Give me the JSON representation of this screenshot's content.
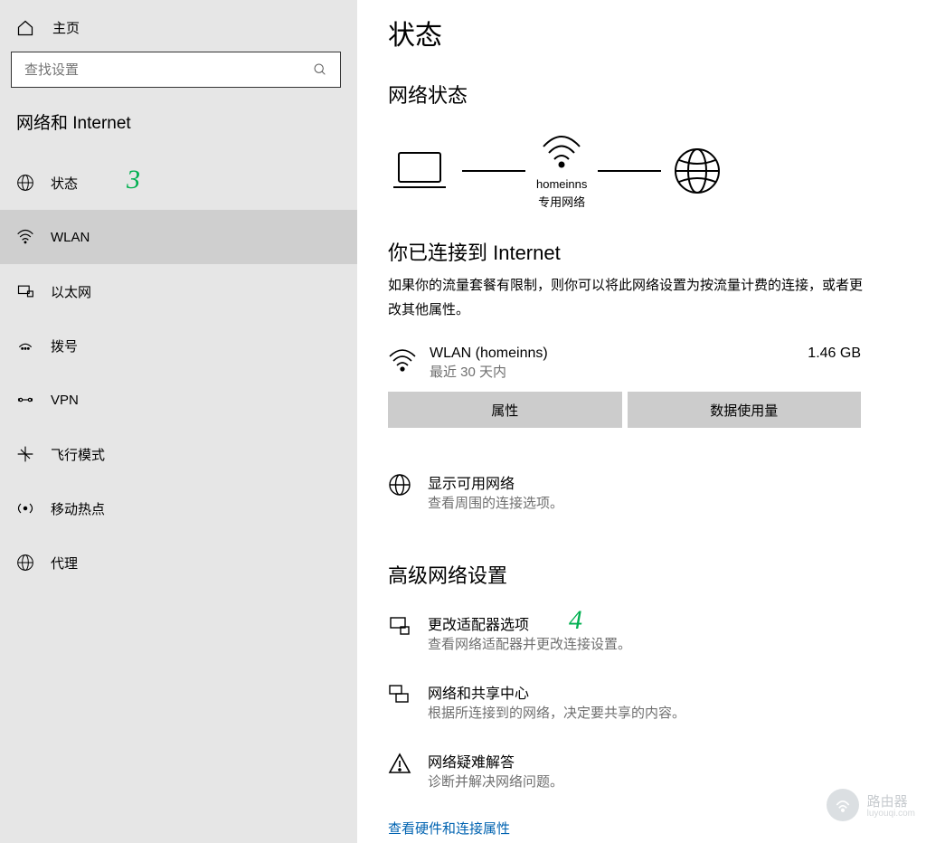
{
  "sidebar": {
    "home": "主页",
    "search_placeholder": "查找设置",
    "title": "网络和 Internet",
    "items": [
      {
        "label": "状态"
      },
      {
        "label": "WLAN"
      },
      {
        "label": "以太网"
      },
      {
        "label": "拨号"
      },
      {
        "label": "VPN"
      },
      {
        "label": "飞行模式"
      },
      {
        "label": "移动热点"
      },
      {
        "label": "代理"
      }
    ]
  },
  "main": {
    "page_title": "状态",
    "network_status_title": "网络状态",
    "diagram": {
      "ssid": "homeinns",
      "net_type": "专用网络"
    },
    "connected_title": "你已连接到 Internet",
    "connected_desc": "如果你的流量套餐有限制，则你可以将此网络设置为按流量计费的连接，或者更改其他属性。",
    "wlan": {
      "name": "WLAN (homeinns)",
      "sub": "最近 30 天内",
      "usage": "1.46 GB",
      "btn_props": "属性",
      "btn_data": "数据使用量"
    },
    "show_networks": {
      "title": "显示可用网络",
      "sub": "查看周围的连接选项。"
    },
    "advanced_title": "高级网络设置",
    "adapter": {
      "title": "更改适配器选项",
      "sub": "查看网络适配器并更改连接设置。"
    },
    "sharing": {
      "title": "网络和共享中心",
      "sub": "根据所连接到的网络，决定要共享的内容。"
    },
    "troubleshoot": {
      "title": "网络疑难解答",
      "sub": "诊断并解决网络问题。"
    },
    "link_hw": "查看硬件和连接属性"
  },
  "annotations": {
    "three": "3",
    "four": "4"
  },
  "watermark": {
    "text": "路由器",
    "sub": "luyouqi.com"
  }
}
